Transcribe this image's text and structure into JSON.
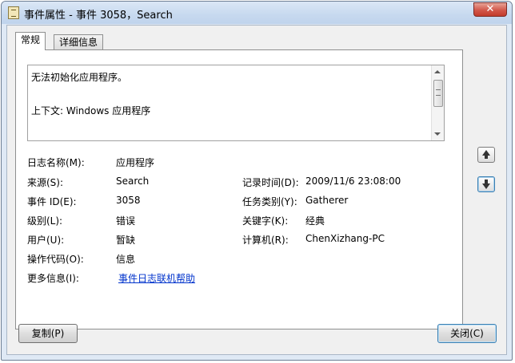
{
  "window": {
    "title": "事件属性 - 事件 3058，Search",
    "close_glyph": "✕"
  },
  "tabs": [
    {
      "label": "常规",
      "active": true
    },
    {
      "label": "详细信息",
      "active": false
    }
  ],
  "description": {
    "line1": "无法初始化应用程序。",
    "line2": "上下文: Windows 应用程序"
  },
  "fields": {
    "log_name": {
      "label": "日志名称(M):",
      "value": "应用程序"
    },
    "source": {
      "label": "来源(S):",
      "value": "Search"
    },
    "logged": {
      "label": "记录时间(D):",
      "value": "2009/11/6 23:08:00"
    },
    "event_id": {
      "label": "事件 ID(E):",
      "value": "3058"
    },
    "task_category": {
      "label": "任务类别(Y):",
      "value": "Gatherer"
    },
    "level": {
      "label": "级别(L):",
      "value": "错误"
    },
    "keywords": {
      "label": "关键字(K):",
      "value": "经典"
    },
    "user": {
      "label": "用户(U):",
      "value": "暂缺"
    },
    "computer": {
      "label": "计算机(R):",
      "value": "ChenXizhang-PC"
    },
    "opcode": {
      "label": "操作代码(O):",
      "value": "信息"
    },
    "more_info": {
      "label": "更多信息(I):",
      "link": "事件日志联机帮助"
    }
  },
  "buttons": {
    "copy": "复制(P)",
    "close": "关闭(C)"
  },
  "icons": {
    "previous": "arrow-up-icon",
    "next": "arrow-down-icon"
  }
}
